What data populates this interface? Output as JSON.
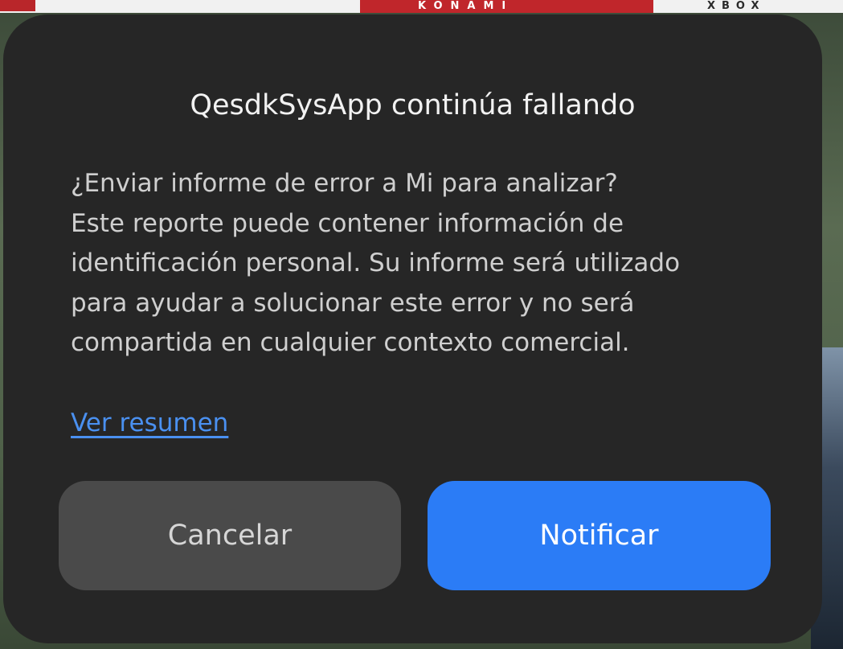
{
  "background": {
    "banner_left_text": "",
    "banner_center_text": "KONAMI",
    "banner_right_text": "XBOX"
  },
  "dialog": {
    "title": "QesdkSysApp continúa fallando",
    "message_lines": [
      "¿Enviar informe de error a Mi para analizar?",
      "Este reporte puede contener información de",
      "identificación personal. Su informe será utilizado",
      "para ayudar a solucionar este error y no será",
      "compartida en cualquier contexto comercial."
    ],
    "link_label": "Ver resumen",
    "cancel_label": "Cancelar",
    "notify_label": "Notificar"
  },
  "colors": {
    "dialog_bg": "#262626",
    "primary_button": "#2b7cf6",
    "secondary_button": "#4a4a4a",
    "link": "#4a90f0"
  }
}
